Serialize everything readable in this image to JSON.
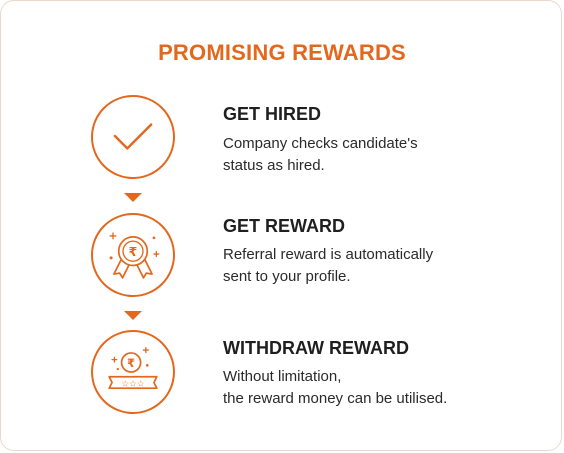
{
  "heading": "PROMISING REWARDS",
  "accent_color": "#e3681d",
  "steps": [
    {
      "icon": "checkmark-icon",
      "title": "GET HIRED",
      "desc_line1": "Company checks candidate's",
      "desc_line2": "status as hired."
    },
    {
      "icon": "reward-medal-icon",
      "title": "GET REWARD",
      "desc_line1": "Referral reward is automatically",
      "desc_line2": "sent to your profile."
    },
    {
      "icon": "withdraw-reward-icon",
      "title": "WITHDRAW REWARD",
      "desc_line1": "Without limitation,",
      "desc_line2": "the reward money can be utilised."
    }
  ]
}
